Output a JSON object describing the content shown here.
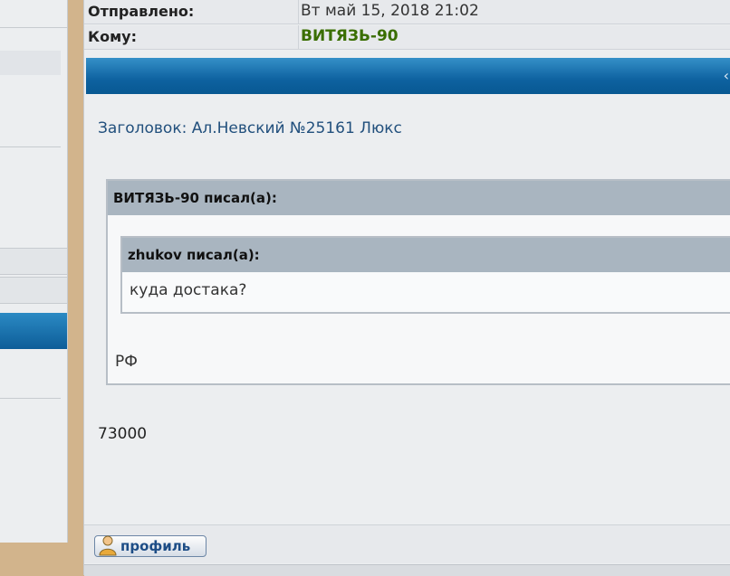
{
  "header": {
    "sent_label": "Отправлено:",
    "sent_value": "Вт май 15, 2018 21:02",
    "to_label": "Кому:",
    "to_value": "ВИТЯЗЬ-90",
    "to_color": "#3a6e00"
  },
  "post": {
    "subject": "Заголовок: Ал.Невский №25161 Люкс",
    "quote_outer_author": "ВИТЯЗЬ-90 писал(а):",
    "quote_inner_author": "zhukov писал(а):",
    "quote_inner_text": "куда достака?",
    "quote_outer_text": "РФ",
    "body_text": "73000"
  },
  "footer": {
    "profile_button": "профиль",
    "profile_icon": "user-icon"
  },
  "colors": {
    "accent_blue": "#0e62a0",
    "quote_header": "#a9b5c0",
    "page_bg": "#d2b48c"
  }
}
